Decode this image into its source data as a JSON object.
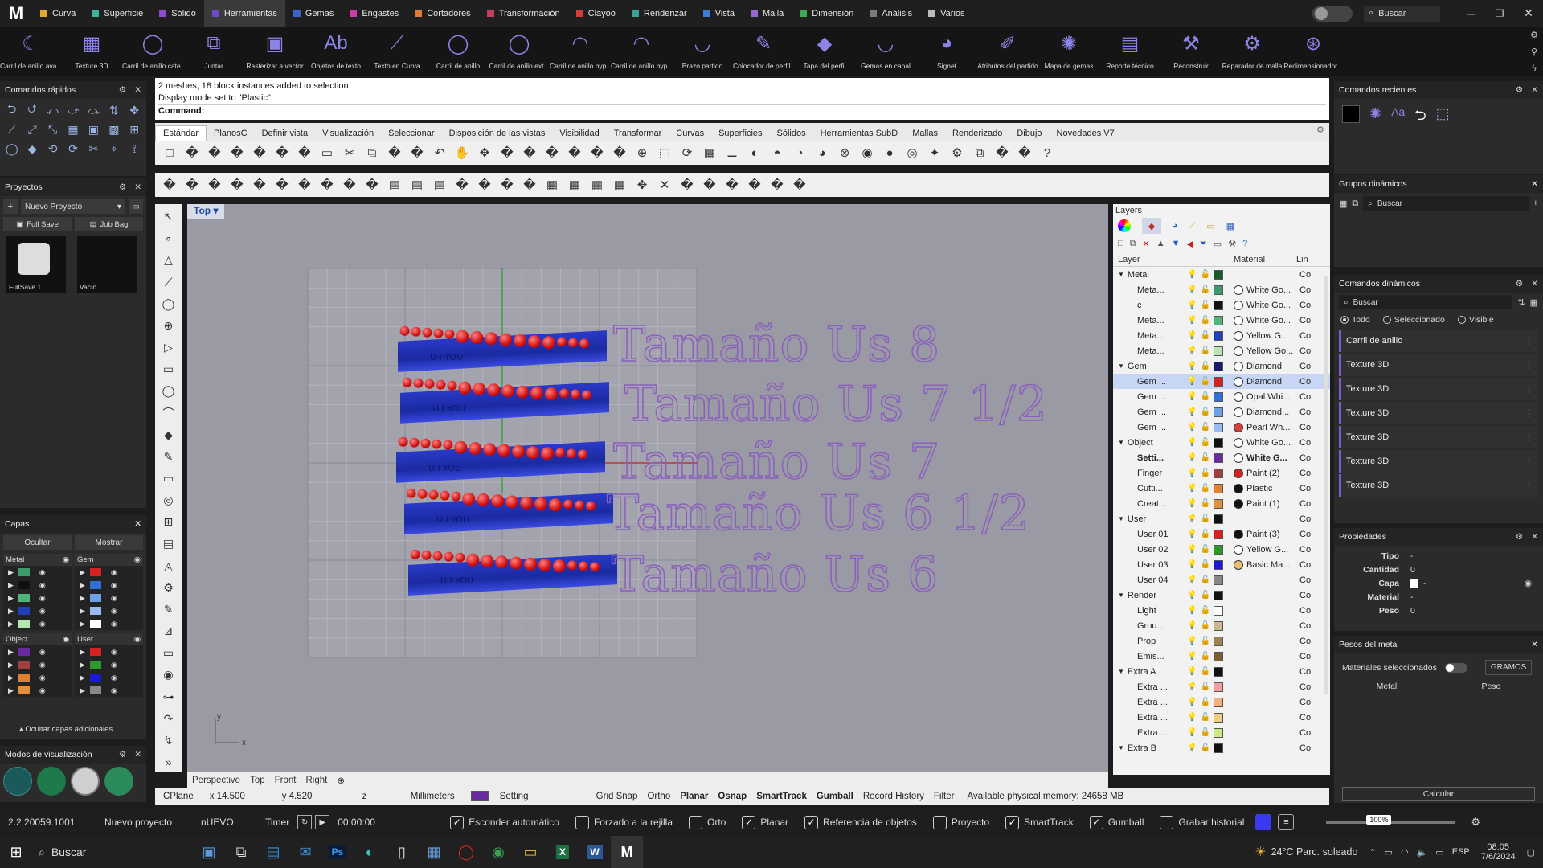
{
  "menubar": {
    "logo": "M",
    "tabs": [
      {
        "label": "Curva",
        "color": "#e0aa2b"
      },
      {
        "label": "Superficie",
        "color": "#37b49a"
      },
      {
        "label": "Sólido",
        "color": "#8e4ad1"
      },
      {
        "label": "Herramientas",
        "color": "#6e49c9",
        "active": true
      },
      {
        "label": "Gemas",
        "color": "#3d63c9"
      },
      {
        "label": "Engastes",
        "color": "#c93da8"
      },
      {
        "label": "Cortadores",
        "color": "#e07b36"
      },
      {
        "label": "Transformación",
        "color": "#c93d5c"
      },
      {
        "label": "Clayoo",
        "color": "#d63b3b"
      },
      {
        "label": "Renderizar",
        "color": "#39a39a"
      },
      {
        "label": "Vista",
        "color": "#3b7ed6"
      },
      {
        "label": "Malla",
        "color": "#9a66d6"
      },
      {
        "label": "Dimensión",
        "color": "#3daa55"
      },
      {
        "label": "Análisis",
        "color": "#7a7a7a"
      },
      {
        "label": "Varios",
        "color": "#bbbbbb"
      }
    ],
    "search": "Buscar"
  },
  "ribbon": [
    {
      "label": "Carril de anillo ava...",
      "icon": "ring-rail-icon"
    },
    {
      "label": "Texture 3D",
      "icon": "texture-icon"
    },
    {
      "label": "Carril de anillo cate...",
      "icon": "ring-icon"
    },
    {
      "label": "Juntar",
      "icon": "join-icon"
    },
    {
      "label": "Rasterizar a vector",
      "icon": "raster-icon"
    },
    {
      "label": "Objetos de texto",
      "icon": "text-object-icon"
    },
    {
      "label": "Texto en Curva",
      "icon": "text-curve-icon"
    },
    {
      "label": "Carril de anillo",
      "icon": "ring-icon"
    },
    {
      "label": "Carril de anillo ext...",
      "icon": "ring-icon"
    },
    {
      "label": "Carril de anillo byp...",
      "icon": "bypass-icon"
    },
    {
      "label": "Carril de anillo byp...",
      "icon": "bypass-icon"
    },
    {
      "label": "Brazo partido",
      "icon": "split-arm-icon"
    },
    {
      "label": "Colocador de perfil...",
      "icon": "profile-icon"
    },
    {
      "label": "Tapa del perfil",
      "icon": "cap-icon"
    },
    {
      "label": "Gemas en canal",
      "icon": "channel-icon"
    },
    {
      "label": "Signet",
      "icon": "signet-icon"
    },
    {
      "label": "Atributos del partido",
      "icon": "attributes-icon"
    },
    {
      "label": "Mapa de gemas",
      "icon": "gem-map-icon"
    },
    {
      "label": "Reporte técnico",
      "icon": "report-icon"
    },
    {
      "label": "Reconstruir",
      "icon": "rebuild-icon"
    },
    {
      "label": "Reparador de malla",
      "icon": "mesh-repair-icon"
    },
    {
      "label": "Redimensionador...",
      "icon": "resize-icon"
    }
  ],
  "left": {
    "quick": "Comandos rápidos",
    "projects": "Proyectos",
    "new_project": "Nuevo Proyecto",
    "full_save": "Full Save",
    "job_bag": "Job Bag",
    "thumb1": "FullSave 1",
    "thumb2": "Vacío",
    "layers": "Capas",
    "hide": "Ocultar",
    "show": "Mostrar",
    "groups": [
      {
        "name": "Metal",
        "colors": [
          "#3f9a6a",
          "#111111",
          "#4fb57a",
          "#1f3fb5",
          "#b5e8b0"
        ]
      },
      {
        "name": "Gem",
        "colors": [
          "#d42222",
          "#2f6fd6",
          "#6ea0e8",
          "#9ab9ee",
          "#ffffff"
        ]
      },
      {
        "name": "Object",
        "colors": [
          "#6a2aa0",
          "#a04040",
          "#e08030",
          "#e09040"
        ]
      },
      {
        "name": "User",
        "colors": [
          "#d42222",
          "#2a9a2a",
          "#1a1ad4",
          "#888888"
        ]
      }
    ],
    "hide_more": "Ocultar capas adicionales",
    "display_modes": "Modos de visualización"
  },
  "command": {
    "line1": "2 meshes, 18 block instances added to selection.",
    "line2": "Display mode set to \"Plastic\".",
    "prompt": "Command:"
  },
  "toolbar_tabs": [
    "Estándar",
    "PlanosC",
    "Definir vista",
    "Visualización",
    "Seleccionar",
    "Disposición de las vistas",
    "Visibilidad",
    "Transformar",
    "Curvas",
    "Superficies",
    "Sólidos",
    "Herramientas SubD",
    "Mallas",
    "Renderizado",
    "Dibujo",
    "Novedades V7"
  ],
  "viewport": {
    "name": "Top",
    "labels": [
      "Tamaño Us 8",
      "Tamaño Us 7 1/2",
      "Tamaño Us 7",
      "Tamaño Us 6 1/2",
      "Tamaño Us 6"
    ],
    "ring_text": "U I YOU"
  },
  "view_tabs": [
    "Perspective",
    "Top",
    "Front",
    "Right"
  ],
  "layers_panel": {
    "title": "Layers",
    "col_layer": "Layer",
    "col_material": "Material",
    "col_lin": "Lin",
    "rows": [
      {
        "name": "Metal",
        "indent": 0,
        "color": "#1a5a2a",
        "mat": "",
        "mc": "",
        "group": true
      },
      {
        "name": "Meta...",
        "indent": 1,
        "color": "#3f9a6a",
        "mat": "White Go...",
        "mc": "#ffffff"
      },
      {
        "name": "c",
        "indent": 1,
        "color": "#111111",
        "mat": "White Go...",
        "mc": "#ffffff"
      },
      {
        "name": "Meta...",
        "indent": 1,
        "color": "#4fb57a",
        "mat": "White Go...",
        "mc": "#ffffff"
      },
      {
        "name": "Meta...",
        "indent": 1,
        "color": "#1f3fb5",
        "mat": "Yellow G...",
        "mc": "#ffffff"
      },
      {
        "name": "Meta...",
        "indent": 1,
        "color": "#b5e8b0",
        "mat": "Yellow Go...",
        "mc": "#ffffff"
      },
      {
        "name": "Gem",
        "indent": 0,
        "color": "#1a1a6a",
        "mat": "Diamond",
        "mc": "#ffffff",
        "group": true
      },
      {
        "name": "Gem ...",
        "indent": 1,
        "color": "#d42222",
        "mat": "Diamond",
        "mc": "#ffffff",
        "sel": true
      },
      {
        "name": "Gem ...",
        "indent": 1,
        "color": "#2f6fd6",
        "mat": "Opal Whi...",
        "mc": "#ffffff"
      },
      {
        "name": "Gem ...",
        "indent": 1,
        "color": "#6ea0e8",
        "mat": "Diamond...",
        "mc": "#ffffff"
      },
      {
        "name": "Gem ...",
        "indent": 1,
        "color": "#9ab9ee",
        "mat": "Pearl Wh...",
        "mc": "#d04040"
      },
      {
        "name": "Object",
        "indent": 0,
        "color": "#111111",
        "mat": "White Go...",
        "mc": "#ffffff",
        "group": true
      },
      {
        "name": "Setti...",
        "indent": 1,
        "color": "#6a2aa0",
        "mat": "White G...",
        "mc": "#ffffff",
        "bold": true
      },
      {
        "name": "Finger",
        "indent": 1,
        "color": "#a04040",
        "mat": "Paint (2)",
        "mc": "#d42222"
      },
      {
        "name": "Cutti...",
        "indent": 1,
        "color": "#e08030",
        "mat": "Plastic",
        "mc": "#111111"
      },
      {
        "name": "Creat...",
        "indent": 1,
        "color": "#e09040",
        "mat": "Paint (1)",
        "mc": "#111111"
      },
      {
        "name": "User",
        "indent": 0,
        "color": "#111111",
        "mat": "",
        "mc": "",
        "group": true
      },
      {
        "name": "User 01",
        "indent": 1,
        "color": "#d42222",
        "mat": "Paint (3)",
        "mc": "#111111"
      },
      {
        "name": "User 02",
        "indent": 1,
        "color": "#2a9a2a",
        "mat": "Yellow G...",
        "mc": "#ffffff"
      },
      {
        "name": "User 03",
        "indent": 1,
        "color": "#1a1ad4",
        "mat": "Basic Ma...",
        "mc": "#e8c070"
      },
      {
        "name": "User 04",
        "indent": 1,
        "color": "#888888",
        "mat": "",
        "mc": ""
      },
      {
        "name": "Render",
        "indent": 0,
        "color": "#111111",
        "mat": "",
        "mc": "",
        "group": true
      },
      {
        "name": "Light",
        "indent": 1,
        "color": "#ffffff",
        "mat": "",
        "mc": ""
      },
      {
        "name": "Grou...",
        "indent": 1,
        "color": "#c8b890",
        "mat": "",
        "mc": ""
      },
      {
        "name": "Prop",
        "indent": 1,
        "color": "#a08050",
        "mat": "",
        "mc": ""
      },
      {
        "name": "Emis...",
        "indent": 1,
        "color": "#7a6030",
        "mat": "",
        "mc": ""
      },
      {
        "name": "Extra A",
        "indent": 0,
        "color": "#111111",
        "mat": "",
        "mc": "",
        "group": true
      },
      {
        "name": "Extra ...",
        "indent": 1,
        "color": "#f0a0a0",
        "mat": "",
        "mc": ""
      },
      {
        "name": "Extra ...",
        "indent": 1,
        "color": "#f0b080",
        "mat": "",
        "mc": ""
      },
      {
        "name": "Extra ...",
        "indent": 1,
        "color": "#f0d080",
        "mat": "",
        "mc": ""
      },
      {
        "name": "Extra ...",
        "indent": 1,
        "color": "#d0e880",
        "mat": "",
        "mc": ""
      },
      {
        "name": "Extra B",
        "indent": 0,
        "color": "#111111",
        "mat": "",
        "mc": "",
        "group": true
      }
    ],
    "lin": "Co"
  },
  "status": {
    "cplane": "CPlane",
    "x": "x 14.500",
    "y": "y 4.520",
    "z": "z",
    "units": "Millimeters",
    "layer": "Setting",
    "layer_color": "#6a2aa0",
    "toggles": [
      "Grid Snap",
      "Ortho",
      "Planar",
      "Osnap",
      "SmartTrack",
      "Gumball",
      "Record History",
      "Filter"
    ],
    "memory": "Available physical memory: 24658 MB"
  },
  "bottom": {
    "version": "2.2.20059.1001",
    "project": "Nuevo proyecto",
    "nuevo": "nUEVO",
    "timer": "Timer",
    "time": "00:00:00",
    "checks": [
      {
        "label": "Esconder automático",
        "on": true
      },
      {
        "label": "Forzado a la rejilla",
        "on": false
      },
      {
        "label": "Orto",
        "on": false
      },
      {
        "label": "Planar",
        "on": true
      },
      {
        "label": "Referencia de objetos",
        "on": true
      },
      {
        "label": "Proyecto",
        "on": false
      },
      {
        "label": "SmartTrack",
        "on": true
      },
      {
        "label": "Gumball",
        "on": true
      },
      {
        "label": "Grabar historial",
        "on": false
      }
    ],
    "zoom": "100%"
  },
  "right": {
    "recent": "Comandos recientes",
    "dyn_groups": "Grupos dinámicos",
    "search": "Buscar",
    "dyn_cmds": "Comandos dinámicos",
    "radio": [
      "Todo",
      "Seleccionado",
      "Visible"
    ],
    "cmd_list": [
      "Carril de anillo",
      "Texture 3D",
      "Texture 3D",
      "Texture 3D",
      "Texture 3D",
      "Texture 3D",
      "Texture 3D",
      "Texture 3D"
    ],
    "props": "Propiedades",
    "prop_rows": [
      {
        "k": "Tipo",
        "v": "-"
      },
      {
        "k": "Cantidad",
        "v": "0"
      },
      {
        "k": "Capa",
        "v": "-"
      },
      {
        "k": "Material",
        "v": "-"
      },
      {
        "k": "Peso",
        "v": "0"
      }
    ],
    "metal_weight": "Pesos del metal",
    "selected_materials": "Materiales seleccionados",
    "grams": "GRAMOS",
    "metal": "Metal",
    "weight": "Peso",
    "calc": "Calcular"
  },
  "taskbar": {
    "search": "Buscar",
    "weather": "24°C  Parc. soleado",
    "lang": "ESP",
    "time": "08:05",
    "date": "7/6/2024"
  }
}
